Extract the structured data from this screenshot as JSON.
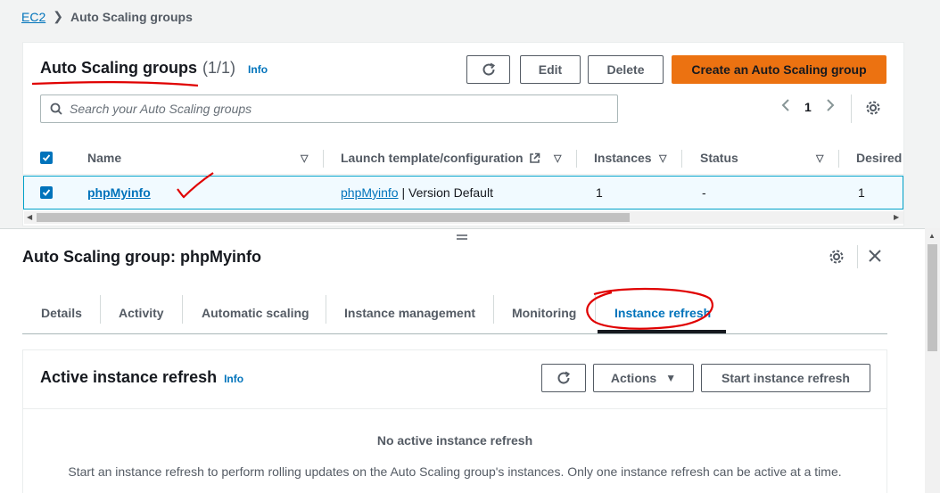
{
  "breadcrumb": {
    "root": "EC2",
    "separator": "❯",
    "current": "Auto Scaling groups"
  },
  "asg_list": {
    "title": "Auto Scaling groups",
    "count": "(1/1)",
    "info": "Info",
    "refresh_icon": "refresh-icon",
    "edit_label": "Edit",
    "delete_label": "Delete",
    "create_label": "Create an Auto Scaling group",
    "search_placeholder": "Search your Auto Scaling groups",
    "page": "1",
    "columns": {
      "name": "Name",
      "launch": "Launch template/configuration",
      "instances": "Instances",
      "status": "Status",
      "desired": "Desired"
    },
    "rows": [
      {
        "name": "phpMyinfo",
        "launch_link": "phpMyinfo",
        "launch_suffix": " | Version Default",
        "instances": "1",
        "status": "-",
        "desired": "1"
      }
    ]
  },
  "detail": {
    "title": "Auto Scaling group: phpMyinfo",
    "tabs": [
      "Details",
      "Activity",
      "Automatic scaling",
      "Instance management",
      "Monitoring",
      "Instance refresh"
    ],
    "active_tab": "Instance refresh",
    "refresh_panel": {
      "title": "Active instance refresh",
      "info": "Info",
      "actions_label": "Actions",
      "start_label": "Start instance refresh",
      "empty_title": "No active instance refresh",
      "empty_desc": "Start an instance refresh to perform rolling updates on the Auto Scaling group's instances. Only one instance refresh can be active at a time."
    }
  },
  "colors": {
    "accent": "#0073bb",
    "primary_button": "#ec7211",
    "annotation": "#e00000"
  }
}
